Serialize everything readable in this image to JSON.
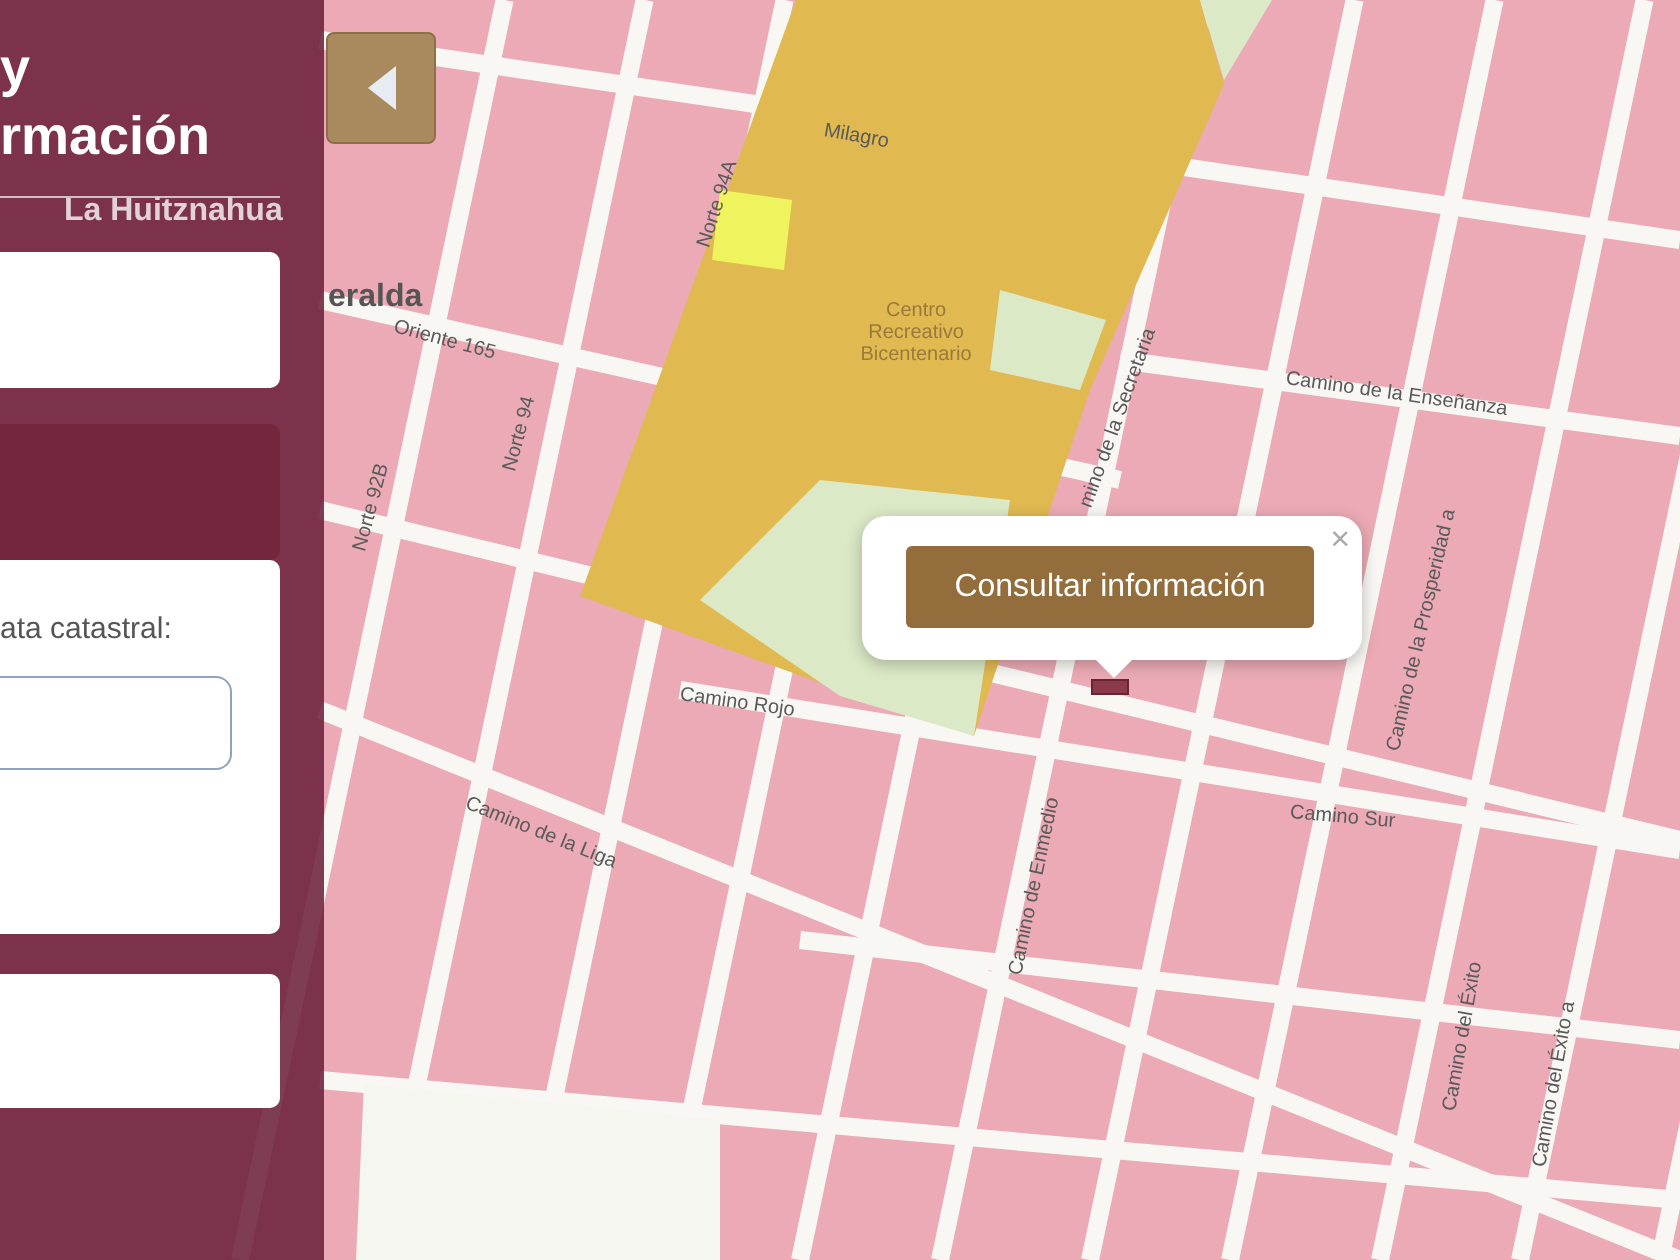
{
  "panel": {
    "title_lines": [
      "y",
      "rmación"
    ],
    "field_label": "ata catastral:"
  },
  "map": {
    "labels": [
      {
        "text": "Milagro"
      },
      {
        "text": "Norte 94A"
      },
      {
        "text": "Oriente 165"
      },
      {
        "text": "Norte 92B"
      },
      {
        "text": "Norte 94"
      },
      {
        "text": "Centro Recreativo Bicentenario"
      },
      {
        "text": "mino de la Secretaria"
      },
      {
        "text": "Camino de la Enseñanza"
      },
      {
        "text": "Camino Rojo"
      },
      {
        "text": "Camino de la Liga"
      },
      {
        "text": "Camino de Enmedio"
      },
      {
        "text": "Camino Sur"
      },
      {
        "text": "Camino del Éxito"
      },
      {
        "text": "Camino del Éxito a"
      },
      {
        "text": "Camino de la Prosperidad a"
      },
      {
        "text": "La Huitznahua"
      },
      {
        "text": "eralda"
      }
    ]
  },
  "popup": {
    "button": "Consultar información",
    "close": "×"
  }
}
